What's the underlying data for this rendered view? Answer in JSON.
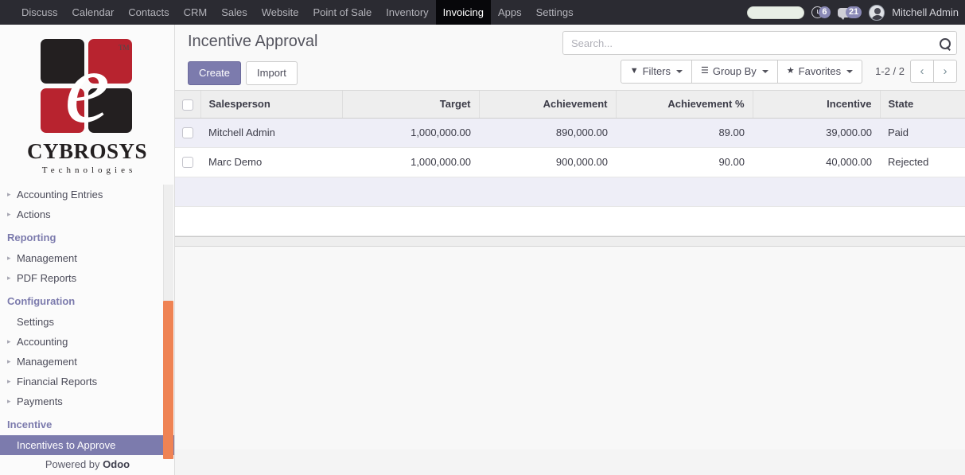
{
  "navbar": {
    "items": [
      {
        "label": "Discuss",
        "active": false
      },
      {
        "label": "Calendar",
        "active": false
      },
      {
        "label": "Contacts",
        "active": false
      },
      {
        "label": "CRM",
        "active": false
      },
      {
        "label": "Sales",
        "active": false
      },
      {
        "label": "Website",
        "active": false
      },
      {
        "label": "Point of Sale",
        "active": false
      },
      {
        "label": "Inventory",
        "active": false
      },
      {
        "label": "Invoicing",
        "active": true
      },
      {
        "label": "Apps",
        "active": false
      },
      {
        "label": "Settings",
        "active": false
      }
    ],
    "activity_icon": "clock-icon",
    "activity_count": "6",
    "messages_icon": "chat-bubble-icon",
    "messages_count": "21",
    "user_name": "Mitchell Admin"
  },
  "sidebar": {
    "logo": {
      "mark_letter": "e",
      "trademark": "TM",
      "name": "CYBROSYS",
      "tagline": "Technologies",
      "colors": {
        "dark": "#231f20",
        "red": "#b8232f"
      }
    },
    "groups": [
      {
        "header": null,
        "items": [
          {
            "label": "Accounting Entries",
            "caret": true,
            "selected": false
          },
          {
            "label": "Actions",
            "caret": true,
            "selected": false
          }
        ]
      },
      {
        "header": "Reporting",
        "items": [
          {
            "label": "Management",
            "caret": true,
            "selected": false
          },
          {
            "label": "PDF Reports",
            "caret": true,
            "selected": false
          }
        ]
      },
      {
        "header": "Configuration",
        "items": [
          {
            "label": "Settings",
            "caret": false,
            "selected": false
          },
          {
            "label": "Accounting",
            "caret": true,
            "selected": false
          },
          {
            "label": "Management",
            "caret": true,
            "selected": false
          },
          {
            "label": "Financial Reports",
            "caret": true,
            "selected": false
          },
          {
            "label": "Payments",
            "caret": true,
            "selected": false
          }
        ]
      },
      {
        "header": "Incentive",
        "items": [
          {
            "label": "Incentives to Approve",
            "caret": false,
            "selected": true
          }
        ]
      }
    ],
    "footer_prefix": "Powered by ",
    "footer_brand": "Odoo",
    "accent_color": "#7c7bad",
    "scrollbar_color": "#ef8354"
  },
  "control_panel": {
    "title": "Incentive Approval",
    "create_label": "Create",
    "import_label": "Import",
    "search_placeholder": "Search...",
    "search_value": "",
    "search_icon": "magnifier-icon",
    "filters_label": "Filters",
    "filters_icon": "funnel-icon",
    "groupby_label": "Group By",
    "groupby_icon": "hamburger-icon",
    "favorites_label": "Favorites",
    "favorites_icon": "star-icon",
    "pager_label": "1-2 / 2",
    "prev_icon": "chevron-left-icon",
    "next_icon": "chevron-right-icon"
  },
  "table": {
    "columns": [
      {
        "label": "Salesperson",
        "align": "left"
      },
      {
        "label": "Target",
        "align": "right"
      },
      {
        "label": "Achievement",
        "align": "right"
      },
      {
        "label": "Achievement %",
        "align": "right"
      },
      {
        "label": "Incentive",
        "align": "right"
      },
      {
        "label": "State",
        "align": "left"
      }
    ],
    "rows": [
      {
        "salesperson": "Mitchell Admin",
        "target": "1,000,000.00",
        "achievement": "890,000.00",
        "achievement_pct": "89.00",
        "incentive": "39,000.00",
        "state": "Paid"
      },
      {
        "salesperson": "Marc Demo",
        "target": "1,000,000.00",
        "achievement": "900,000.00",
        "achievement_pct": "90.00",
        "incentive": "40,000.00",
        "state": "Rejected"
      }
    ]
  }
}
